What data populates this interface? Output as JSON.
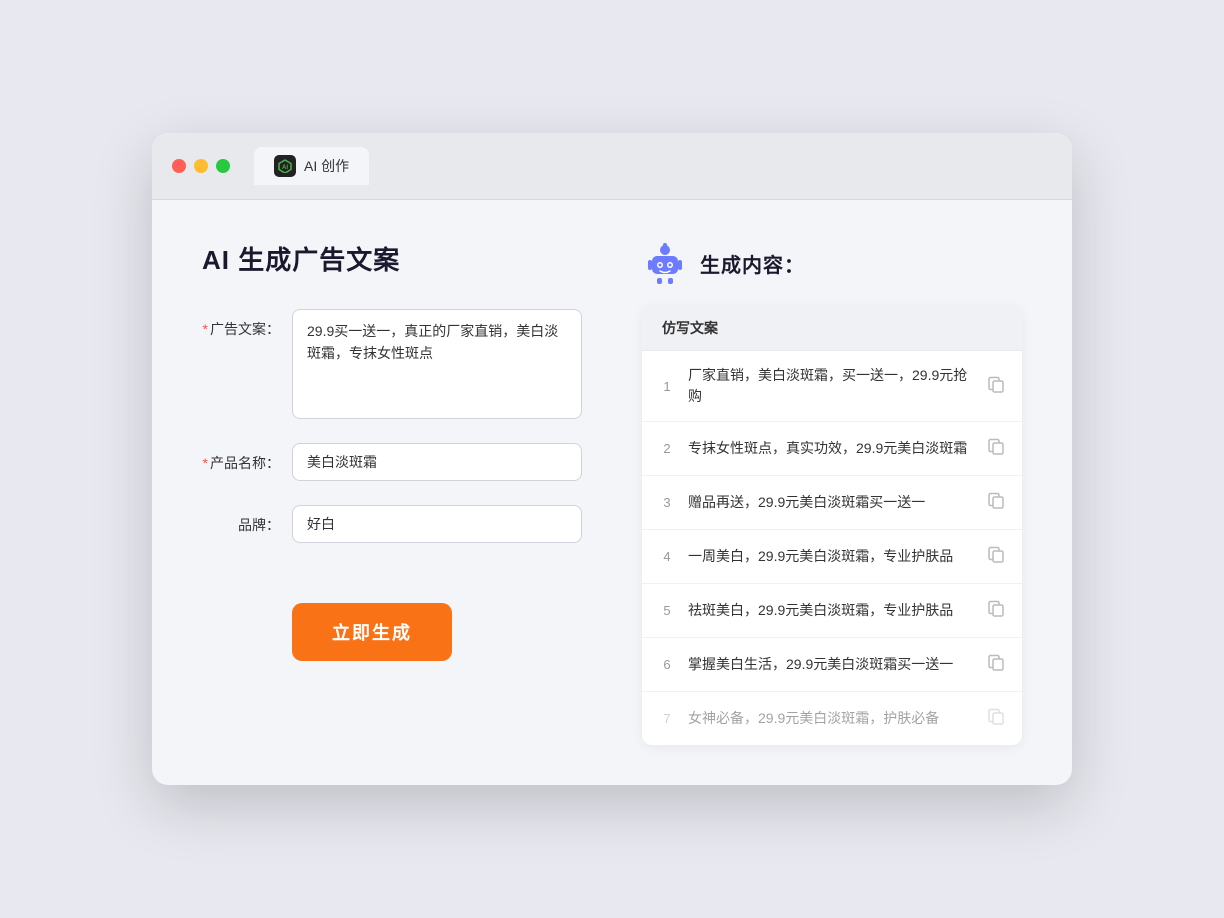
{
  "browser": {
    "tab_label": "AI 创作"
  },
  "page": {
    "title": "AI 生成广告文案"
  },
  "form": {
    "ad_label": "广告文案：",
    "ad_required": "*",
    "ad_value": "29.9买一送一，真正的厂家直销，美白淡斑霜，专抹女性斑点",
    "product_label": "产品名称：",
    "product_required": "*",
    "product_value": "美白淡斑霜",
    "brand_label": "品牌：",
    "brand_value": "好白",
    "button_label": "立即生成"
  },
  "result": {
    "header": "生成内容：",
    "column_label": "仿写文案",
    "items": [
      {
        "num": "1",
        "text": "厂家直销，美白淡斑霜，买一送一，29.9元抢购",
        "dimmed": false
      },
      {
        "num": "2",
        "text": "专抹女性斑点，真实功效，29.9元美白淡斑霜",
        "dimmed": false
      },
      {
        "num": "3",
        "text": "赠品再送，29.9元美白淡斑霜买一送一",
        "dimmed": false
      },
      {
        "num": "4",
        "text": "一周美白，29.9元美白淡斑霜，专业护肤品",
        "dimmed": false
      },
      {
        "num": "5",
        "text": "祛斑美白，29.9元美白淡斑霜，专业护肤品",
        "dimmed": false
      },
      {
        "num": "6",
        "text": "掌握美白生活，29.9元美白淡斑霜买一送一",
        "dimmed": false
      },
      {
        "num": "7",
        "text": "女神必备，29.9元美白淡斑霜，护肤必备",
        "dimmed": true
      }
    ]
  }
}
